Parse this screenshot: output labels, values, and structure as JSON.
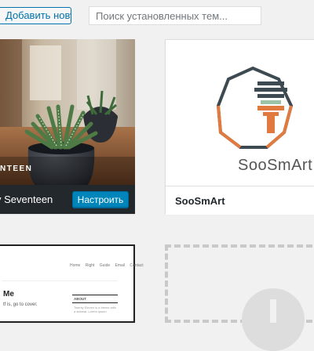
{
  "toolbar": {
    "add_new_label": "Добавить новую",
    "search_placeholder": "Поиск установленных тем..."
  },
  "themes": [
    {
      "name": "y Seventeen",
      "screenshot_brand": "NTEEN",
      "active": true,
      "action_label": "Настроить"
    },
    {
      "name": "SooSmArt",
      "logo_text": "SooSmArt",
      "active": false
    },
    {
      "name": "",
      "preview_nav": "Home  Right Guide  Email  Contact",
      "preview_title": "Me",
      "preview_text": "tf is, go to cover.",
      "preview_sidebar_title": "ABOUT",
      "preview_sidebar_text": "Twenty Eleven is a theme with a sidebar. Lorem ipsum"
    }
  ],
  "colors": {
    "accent": "#0073aa",
    "primary_button": "#0085ba",
    "logo_dark": "#3d4a52",
    "logo_orange": "#e07a3e"
  }
}
